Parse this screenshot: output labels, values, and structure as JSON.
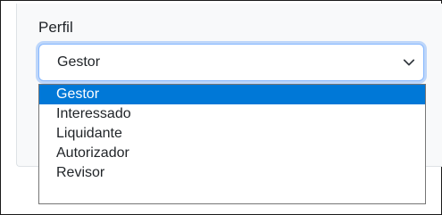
{
  "form": {
    "perfil_label": "Perfil",
    "perfil_selected": "Gestor",
    "perfil_options": [
      "Gestor",
      "Interessado",
      "Liquidante",
      "Autorizador",
      "Revisor"
    ],
    "selected_index": 0
  },
  "icons": {
    "select_toggle": "chevron-down-icon"
  },
  "colors": {
    "highlight": "#0078d7",
    "focus_border": "#86b7fe"
  }
}
